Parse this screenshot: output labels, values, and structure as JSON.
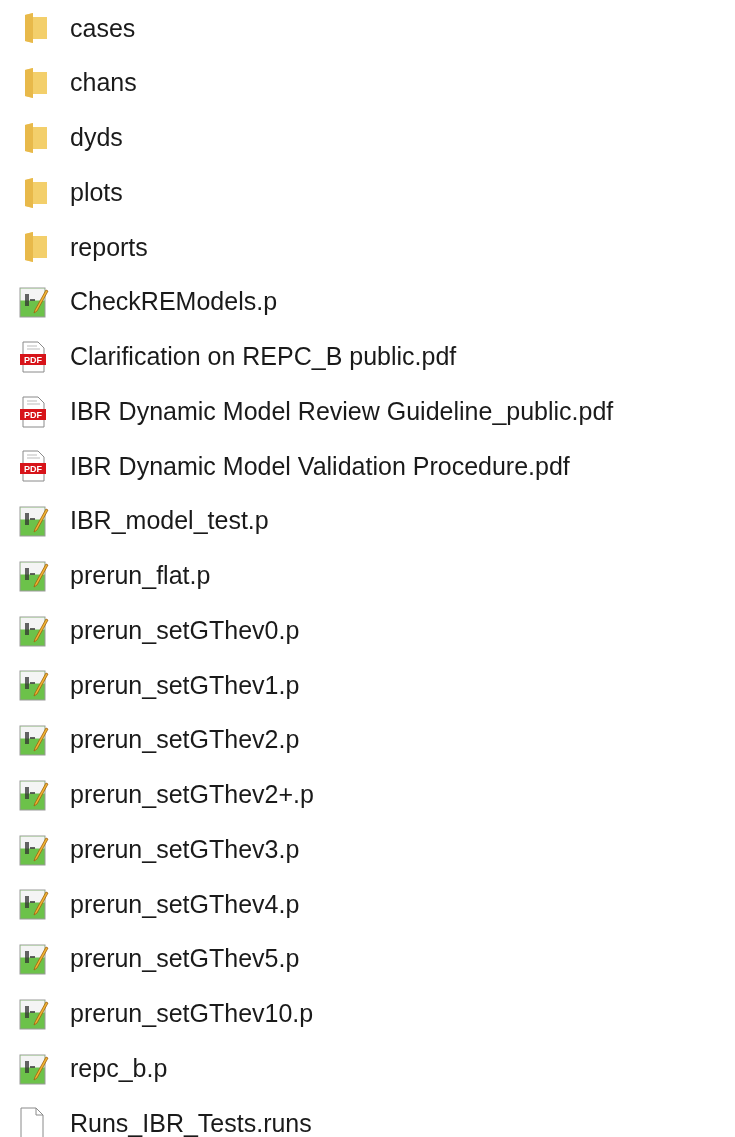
{
  "files": [
    {
      "name": "cases",
      "kind": "folder"
    },
    {
      "name": "chans",
      "kind": "folder"
    },
    {
      "name": "dyds",
      "kind": "folder"
    },
    {
      "name": "plots",
      "kind": "folder"
    },
    {
      "name": "reports",
      "kind": "folder"
    },
    {
      "name": "CheckREModels.p",
      "kind": "script"
    },
    {
      "name": "Clarification on REPC_B public.pdf",
      "kind": "pdf",
      "icon_text": "PDF"
    },
    {
      "name": "IBR Dynamic Model Review Guideline_public.pdf",
      "kind": "pdf",
      "icon_text": "PDF"
    },
    {
      "name": "IBR Dynamic Model Validation Procedure.pdf",
      "kind": "pdf",
      "icon_text": "PDF"
    },
    {
      "name": "IBR_model_test.p",
      "kind": "script"
    },
    {
      "name": "prerun_flat.p",
      "kind": "script"
    },
    {
      "name": "prerun_setGThev0.p",
      "kind": "script"
    },
    {
      "name": "prerun_setGThev1.p",
      "kind": "script"
    },
    {
      "name": "prerun_setGThev2.p",
      "kind": "script"
    },
    {
      "name": "prerun_setGThev2+.p",
      "kind": "script"
    },
    {
      "name": "prerun_setGThev3.p",
      "kind": "script"
    },
    {
      "name": "prerun_setGThev4.p",
      "kind": "script"
    },
    {
      "name": "prerun_setGThev5.p",
      "kind": "script"
    },
    {
      "name": "prerun_setGThev10.p",
      "kind": "script"
    },
    {
      "name": "repc_b.p",
      "kind": "script"
    },
    {
      "name": "Runs_IBR_Tests.runs",
      "kind": "file"
    }
  ]
}
